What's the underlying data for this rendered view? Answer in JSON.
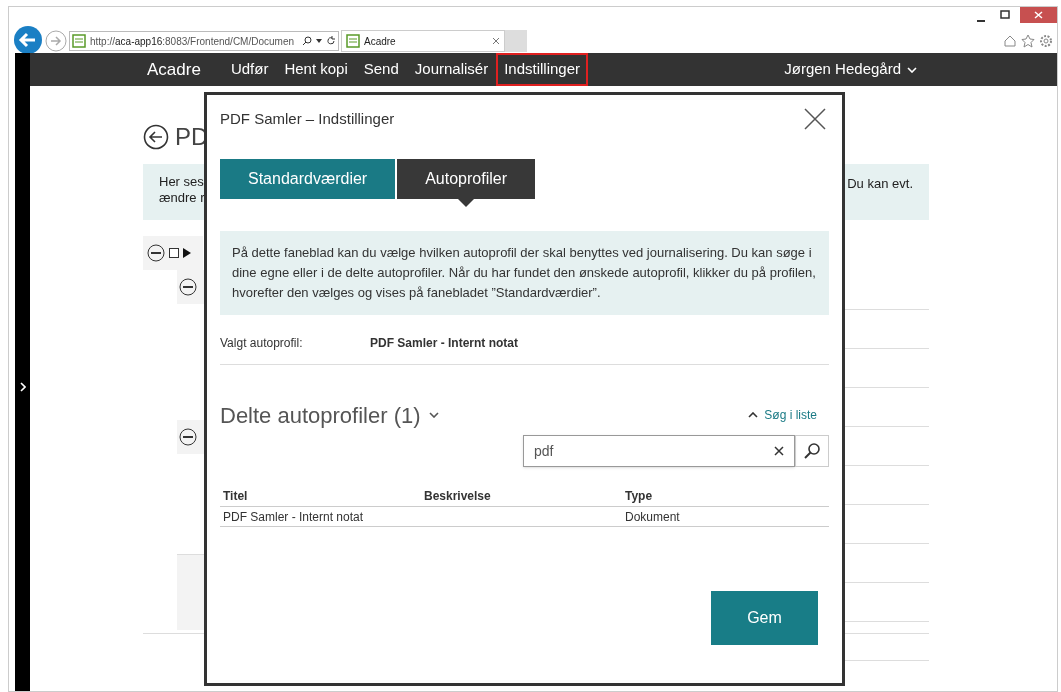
{
  "browser": {
    "url_prefix": "http://",
    "url_host": "aca-app16",
    "url_rest": ":8083/Frontend/CM/Documen",
    "tab_title": "Acadre"
  },
  "nav": {
    "brand": "Acadre",
    "items": [
      {
        "label": "Udfør",
        "selected": false
      },
      {
        "label": "Hent kopi",
        "selected": false
      },
      {
        "label": "Send",
        "selected": false
      },
      {
        "label": "Journalisér",
        "selected": false
      },
      {
        "label": "Indstillinger",
        "selected": true
      }
    ],
    "user": "Jørgen Hedegård"
  },
  "background": {
    "title": "PD",
    "checkbox_checked": false,
    "info_left": [
      "Her ses",
      "ændre r"
    ],
    "info_right": "Du kan evt."
  },
  "dialog": {
    "title": "PDF Samler – Indstillinger",
    "tabs": [
      {
        "label": "Standardværdier",
        "selected": false
      },
      {
        "label": "Autoprofiler",
        "selected": true
      }
    ],
    "info": "På dette faneblad kan du vælge hvilken autoprofil der skal benyttes ved journalisering. Du kan søge i dine egne eller i de delte autoprofiler. Når du har fundet den ønskede autoprofil, klikker du på profilen, hvorefter den vælges og vises på fanebladet ”Standardværdier”.",
    "selected_label": "Valgt autoprofil:",
    "selected_value": "PDF Samler - Internt notat",
    "section_title": "Delte autoprofiler (1)",
    "search_toggle": "Søg i liste",
    "search_value": "pdf",
    "table": {
      "columns": [
        "Titel",
        "Beskrivelse",
        "Type"
      ],
      "rows": [
        [
          "PDF Samler - Internt notat",
          "",
          "Dokument"
        ]
      ]
    },
    "save_button": "Gem"
  }
}
